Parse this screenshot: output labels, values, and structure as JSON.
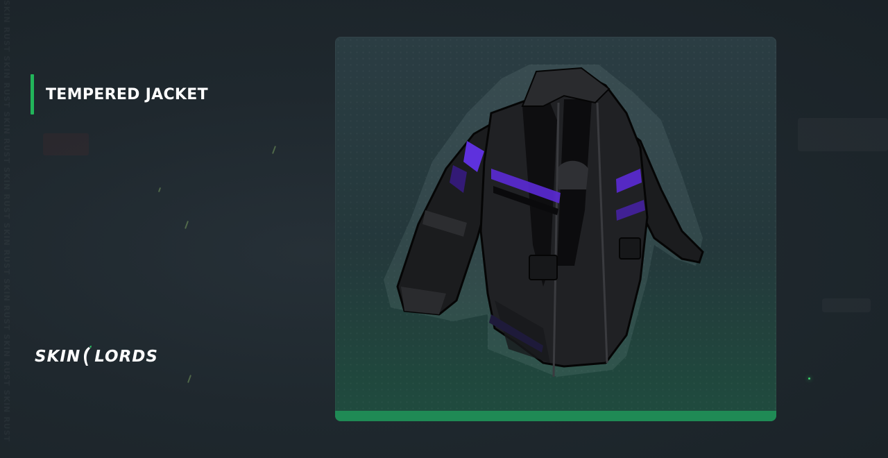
{
  "item": {
    "name": "TEMPERED JACKET",
    "image_icon": "jacket-icon"
  },
  "brand": {
    "logo_left": "SKIN",
    "logo_right": "LORDS",
    "logo_icon": "sickle-logo-icon"
  },
  "watermark": {
    "side_text": "SKIN RUST SKIN RUST SKIN RUST SKIN RUST SKIN RUST SKIN RUST SKIN RUST SKIN RUST"
  },
  "colors": {
    "accent_green": "#22b45a",
    "card_bottom_bar": "#1f8a55",
    "jacket_stripe_purple": "#5b2ad6"
  }
}
